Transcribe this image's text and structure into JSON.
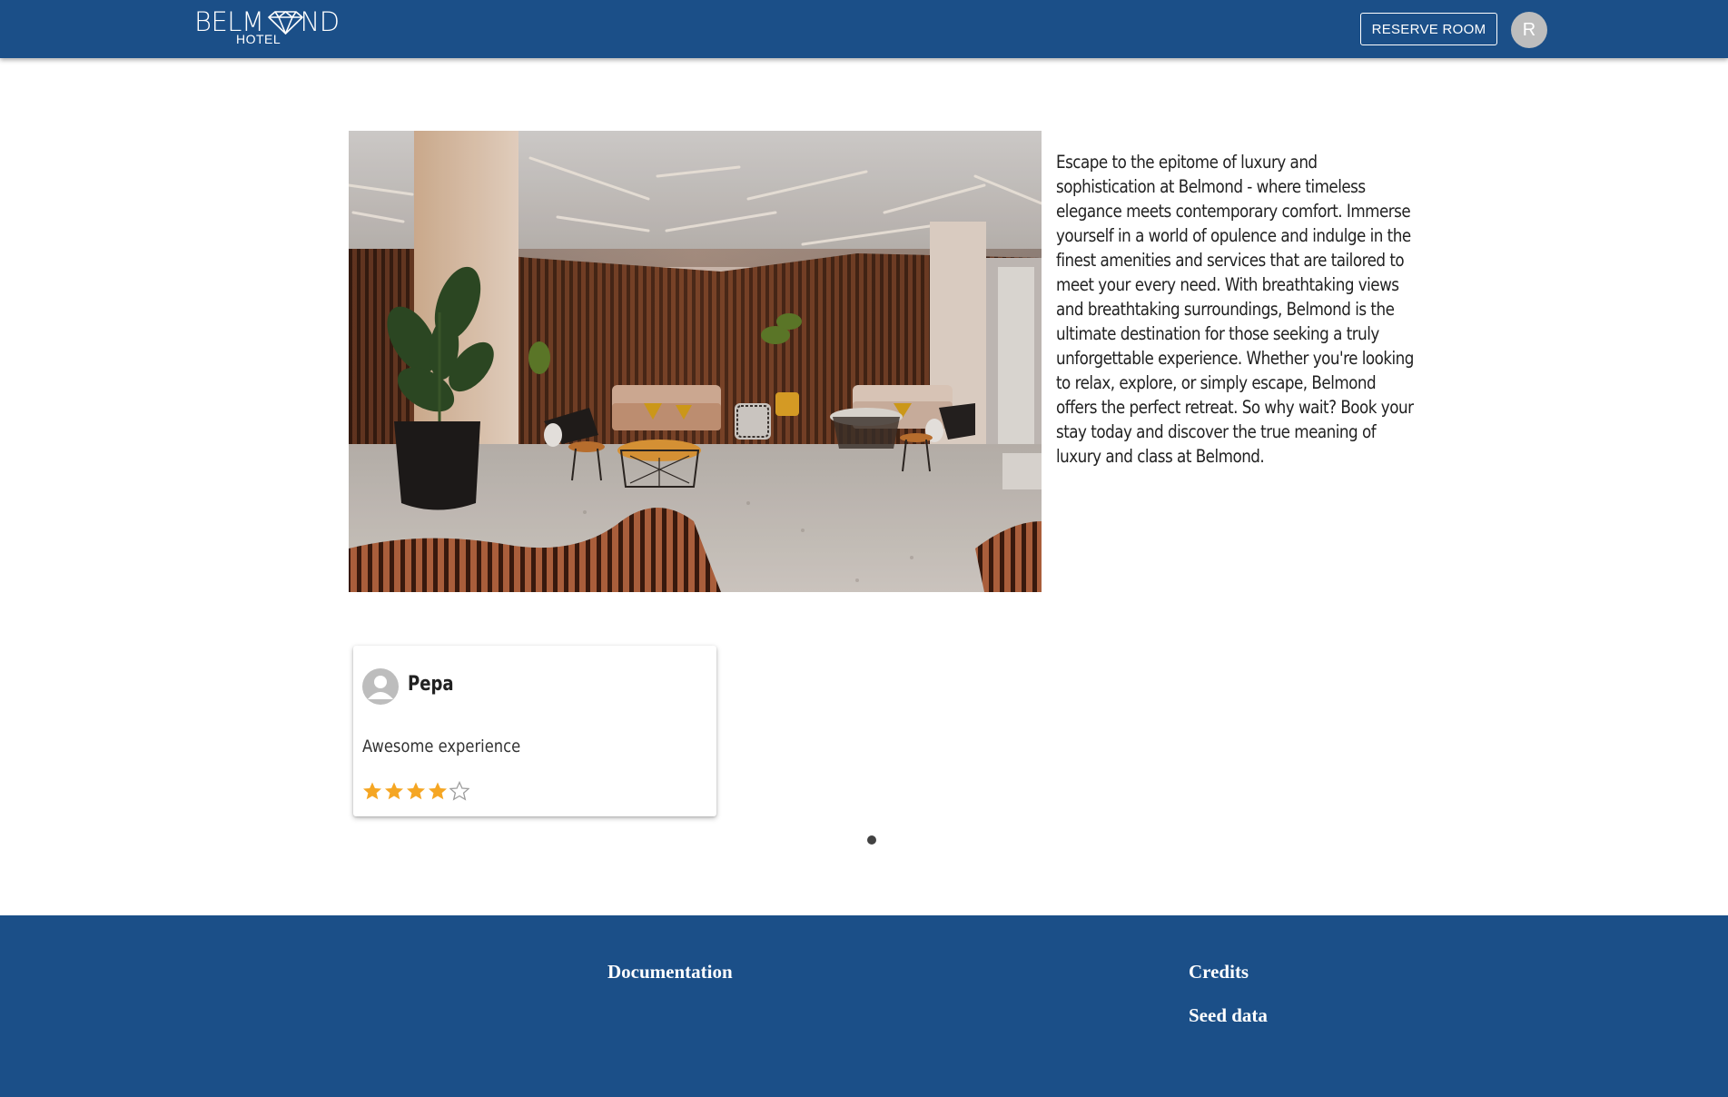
{
  "header": {
    "logo_word_left": "BELM",
    "logo_word_right": "ND",
    "logo_sub": "HOTEL",
    "reserve_label": "RESERVE ROOM",
    "avatar_initial": "R",
    "bar_color": "#1b4f88"
  },
  "hero": {
    "description": "Escape to the epitome of luxury and sophistication at Belmond - where timeless elegance meets contemporary comfort. Immerse yourself in a world of opulence and indulge in the finest amenities and services that are tailored to meet your every need. With breathtaking views and breathtaking surroundings, Belmond is the ultimate destination for those seeking a truly unforgettable experience. Whether you're looking to relax, explore, or simply escape, Belmond offers the perfect retreat. So why wait? Book your stay today and discover the true meaning of luxury and class at Belmond."
  },
  "reviews": [
    {
      "name": "Pepa",
      "text": "Awesome experience",
      "rating": 4,
      "max_rating": 5
    }
  ],
  "carousel": {
    "page_count": 1,
    "active_page": 1
  },
  "footer": {
    "documentation_label": "Documentation",
    "credits_label": "Credits",
    "seed_data_label": "Seed data"
  },
  "colors": {
    "primary": "#1b4f88",
    "star": "#f5a623",
    "star_empty": "#9e9e9e"
  }
}
